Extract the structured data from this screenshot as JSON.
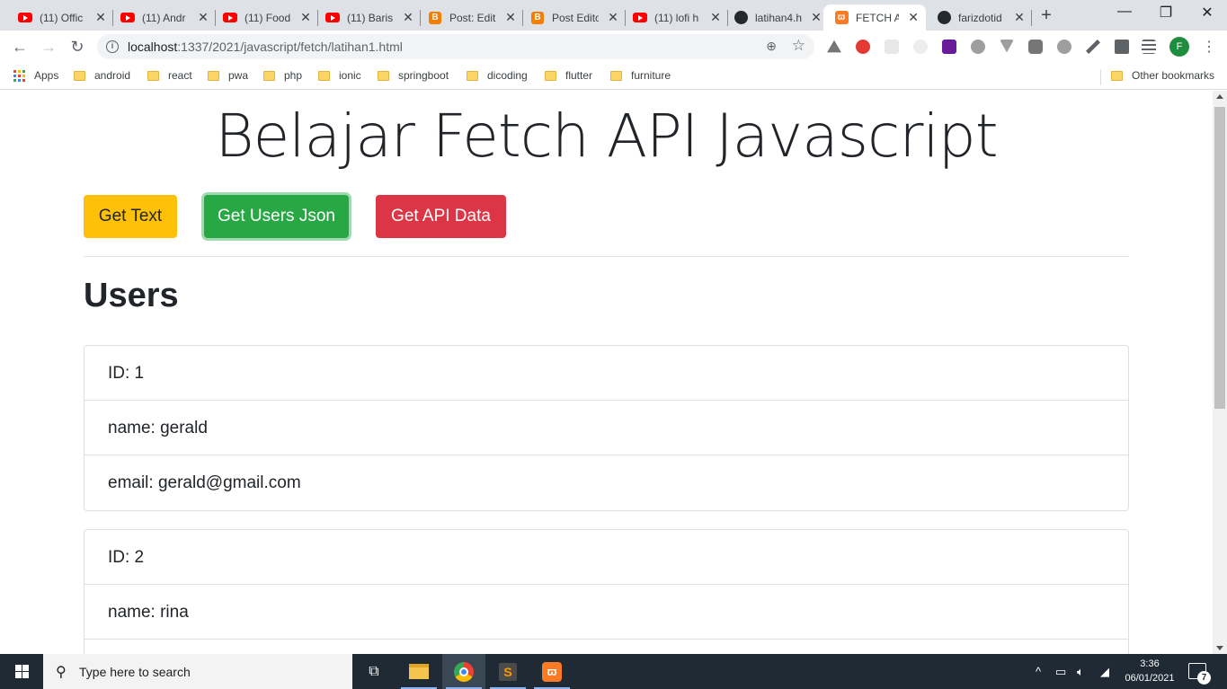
{
  "browser": {
    "tabs": [
      {
        "title": "(11) Offic",
        "favicon": "youtube-icon"
      },
      {
        "title": "(11) Andr",
        "favicon": "youtube-icon"
      },
      {
        "title": "(11) Food",
        "favicon": "youtube-icon"
      },
      {
        "title": "(11) Baris",
        "favicon": "youtube-icon"
      },
      {
        "title": "Post: Edit",
        "favicon": "blogger-icon"
      },
      {
        "title": "Post Edito",
        "favicon": "blogger-icon"
      },
      {
        "title": "(11) lofi h",
        "favicon": "youtube-icon"
      },
      {
        "title": "latihan4.h",
        "favicon": "github-icon"
      },
      {
        "title": "FETCH AP",
        "favicon": "xampp-icon",
        "active": true
      },
      {
        "title": "farizdotid",
        "favicon": "github-icon"
      }
    ],
    "new_tab": "+",
    "window_controls": {
      "minimize": "—",
      "restore": "❐",
      "close": "✕"
    },
    "address": {
      "host": "localhost",
      "path": ":1337/2021/javascript/fetch/latihan1.html"
    },
    "bookmarks": {
      "apps_label": "Apps",
      "items": [
        "android",
        "react",
        "pwa",
        "php",
        "ionic",
        "springboot",
        "dicoding",
        "flutter",
        "furniture"
      ],
      "other": "Other bookmarks"
    },
    "profile_initial": "F",
    "colors": {
      "tab_strip": "#dee1e6",
      "omnibox": "#f1f3f4"
    }
  },
  "page": {
    "title": "Belajar Fetch API Javascript",
    "buttons": {
      "get_text": "Get Text",
      "get_users": "Get Users Json",
      "get_api": "Get API Data"
    },
    "section_title": "Users",
    "users": [
      {
        "id": "ID: 1",
        "name": "name: gerald",
        "email": "email: gerald@gmail.com"
      },
      {
        "id": "ID: 2",
        "name": "name: rina"
      }
    ],
    "colors": {
      "warning": "#ffc107",
      "success": "#28a745",
      "danger": "#dc3545"
    }
  },
  "taskbar": {
    "search_placeholder": "Type here to search",
    "time": "3:36",
    "date": "06/01/2021",
    "notification_count": "7"
  }
}
